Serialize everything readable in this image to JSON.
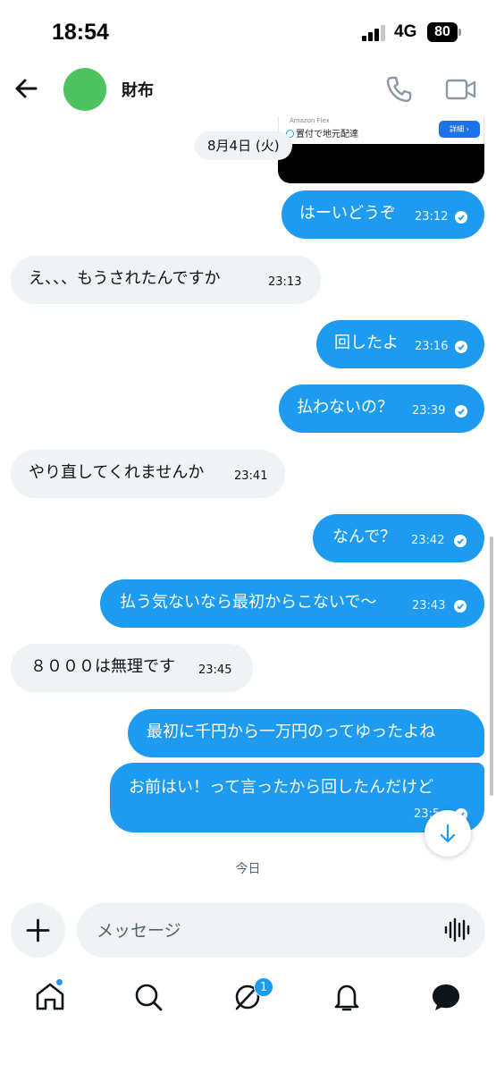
{
  "status_bar": {
    "time": "18:54",
    "network": "4G",
    "battery": "80"
  },
  "header": {
    "contact_name": "財布"
  },
  "media_card": {
    "brand": "Amazon Flex",
    "subtitle": "置付で地元配達",
    "button": "詳細 ›"
  },
  "date_separator": "8月4日 (火)",
  "messages": [
    {
      "dir": "out",
      "text": "はーいどうぞ",
      "time": "23:12"
    },
    {
      "dir": "in",
      "text": "え、、、もうされたんですか",
      "time": "23:13"
    },
    {
      "dir": "out",
      "text": "回したよ",
      "time": "23:16"
    },
    {
      "dir": "out",
      "text": "払わないの？",
      "time": "23:39"
    },
    {
      "dir": "in",
      "text": "やり直してくれませんか",
      "time": "23:41"
    },
    {
      "dir": "out",
      "text": "なんで？",
      "time": "23:42"
    },
    {
      "dir": "out",
      "text": "払う気ないなら最初からこないで〜",
      "time": "23:43"
    },
    {
      "dir": "in",
      "text": "８０００は無理です",
      "time": "23:45"
    },
    {
      "dir": "out",
      "text": "最初に千円から一万円のってゆったよね",
      "time": ""
    },
    {
      "dir": "out",
      "text": "お前はい！って言ったから回したんだけど",
      "time": "23:5"
    }
  ],
  "today_label": "今日",
  "composer": {
    "placeholder": "メッセージ"
  },
  "nav": {
    "messages_badge": "1"
  },
  "colors": {
    "accent": "#1d9bf0",
    "incoming_bubble": "#eff3f4",
    "avatar": "#4cc35e"
  }
}
